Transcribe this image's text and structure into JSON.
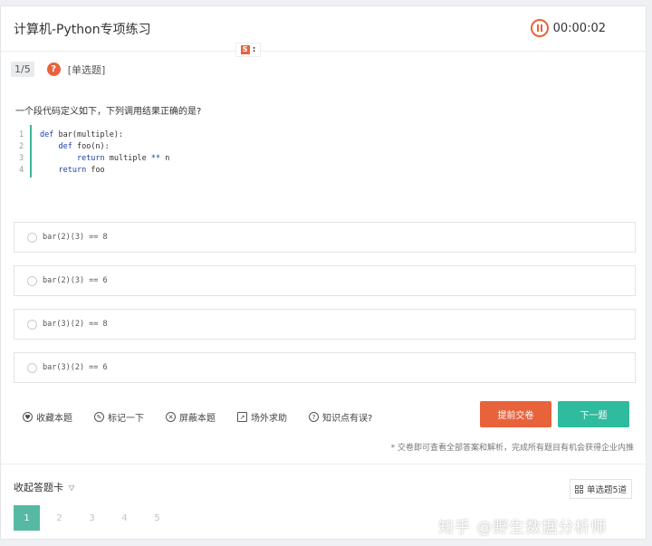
{
  "header": {
    "title": "计算机-Python专项练习",
    "timer": "00:00:02"
  },
  "ext": {
    "label": "S",
    "dots": ":"
  },
  "question": {
    "progress": "1/5",
    "help": "?",
    "type": "[单选题]",
    "text": "一个段代码定义如下，下列调用结果正确的是?",
    "code": {
      "line_numbers": [
        "1",
        "2",
        "3",
        "4"
      ],
      "lines": [
        "def bar(multiple):",
        "    def foo(n):",
        "        return multiple ** n",
        "    return foo"
      ]
    }
  },
  "options": [
    "bar(2)(3) == 8",
    "bar(2)(3) == 6",
    "bar(3)(2) == 8",
    "bar(3)(2) == 6"
  ],
  "tools": [
    "收藏本题",
    "标记一下",
    "屏蔽本题",
    "场外求助",
    "知识点有误?"
  ],
  "buttons": {
    "submit": "提前交卷",
    "next": "下一题"
  },
  "note": "* 交卷即可查看全部答案和解析，完成所有题目有机会获得企业内推",
  "answer_card": {
    "toggle": "收起答题卡",
    "type": "单选题5道",
    "numbers": [
      "1",
      "2",
      "3",
      "4",
      "5"
    ],
    "current": 1
  },
  "watermark": "知乎 @野生数据分析师",
  "colors": {
    "accent": "#e8633c",
    "primary": "#2fbb9d",
    "active_number": "#55b9a3"
  }
}
